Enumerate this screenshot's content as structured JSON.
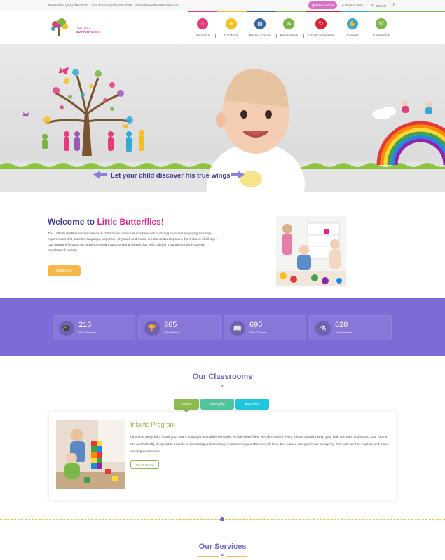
{
  "topbar": {
    "phone_pleasanton": "Pleasanton (925) 940-8870",
    "phone_sanramon": "San Ramon (510) 755-7046",
    "email": "admin@thelittlebutterflies.com",
    "tour_button": "Take a Virtual",
    "stop_by": "Stop in Now",
    "call_us": "Call us!",
    "facebook": "f"
  },
  "logo": {
    "line1": "THE LITTLE",
    "line2": "BUTTERFLIES"
  },
  "nav": [
    {
      "label": "About Us",
      "color": "#e53b7d",
      "icon": "building-icon",
      "glyph": "⌂"
    },
    {
      "label": "Locations",
      "color": "#f4bf1f",
      "icon": "map-pin-icon",
      "glyph": "●"
    },
    {
      "label": "Parent Corner",
      "color": "#34679c",
      "icon": "book-icon",
      "glyph": "▤"
    },
    {
      "label": "Testimonials",
      "color": "#7cb444",
      "icon": "chat-bubble-icon",
      "glyph": "✉"
    },
    {
      "label": "Activity Schedules",
      "color": "#d72638",
      "icon": "schedule-icon",
      "glyph": "↻"
    },
    {
      "label": "Careers",
      "color": "#33a9d6",
      "icon": "handshake-icon",
      "glyph": "✋"
    },
    {
      "label": "Contact Us",
      "color": "#7bb94a",
      "icon": "contact-icon",
      "glyph": "☏"
    }
  ],
  "hero": {
    "caption": "Let your child discover his true wings"
  },
  "welcome": {
    "title_prefix": "Welcome to ",
    "title_highlight": "Little Butterflies!",
    "body": "The Little Butterflies recognizes each child as an individual and provides nurturing care and engaging learning experiences that promote language, cognitive, physical, and social-emotional development, for children of all age. Our program focuses on developmentally appropriate activities that help children mature into well-rounded members of society.",
    "button": "Read more"
  },
  "stats": [
    {
      "value": "216",
      "label": "New Students",
      "icon": "graduation-cap-icon",
      "glyph": "🎓"
    },
    {
      "value": "365",
      "label": "Gold Medals",
      "icon": "trophy-icon",
      "glyph": "🏆"
    },
    {
      "value": "695",
      "label": "Total Courses",
      "icon": "book-icon",
      "glyph": "📖"
    },
    {
      "value": "628",
      "label": "Total Activities",
      "icon": "flask-icon",
      "glyph": "⚗"
    }
  ],
  "classrooms": {
    "title": "Our Classrooms",
    "tabs": [
      {
        "label": "Infant",
        "color": "#8cbb4e"
      },
      {
        "label": "Caterpillar",
        "color": "#52c59e"
      },
      {
        "label": "Butterflies",
        "color": "#1fc5df"
      }
    ],
    "program_title": "Infants Program",
    "program_text": "First time away from home your infant could get overwhelmed easily. At little butterflies, we take care of every minute detail to keep your little one safe and sound. Our rooms are aesthetically designed to provide a stimulating and soothing environment your little one will love. Our trained caregivers are always by their side as they explore and make exciting discoveries.",
    "button": "READ MORE"
  },
  "services": {
    "title": "Our Services"
  }
}
